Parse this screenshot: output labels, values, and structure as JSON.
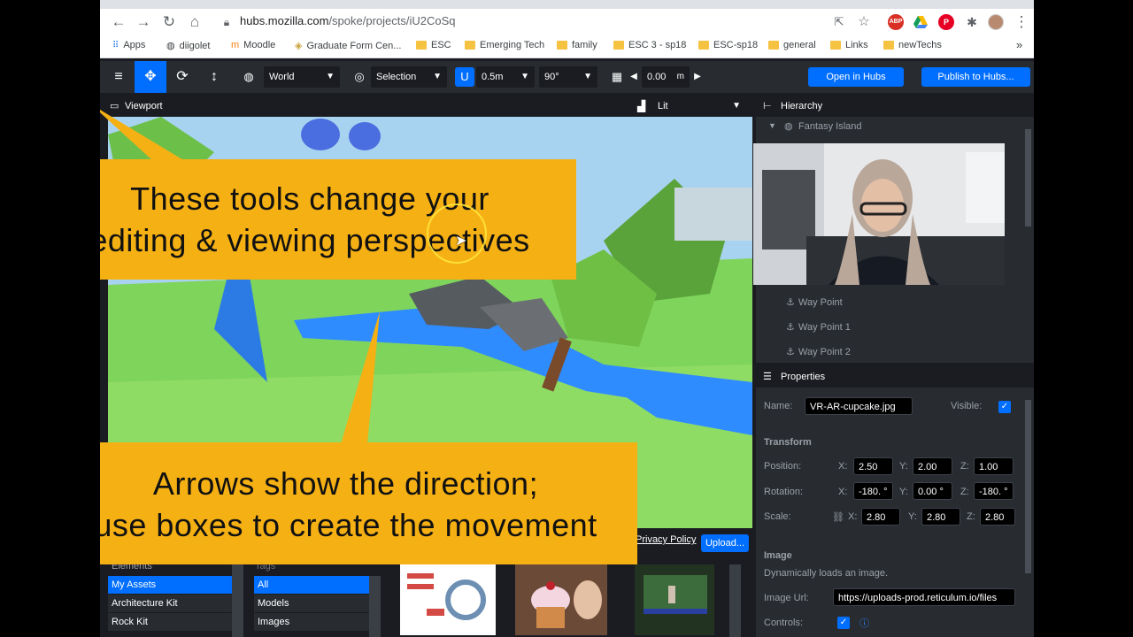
{
  "browser": {
    "url_host": "hubs.mozilla.com",
    "url_path": "/spoke/projects/iU2CoSq",
    "extensions": [
      "ABP",
      "drive-icon",
      "pinterest-icon",
      "puzzle-icon",
      "profile-avatar"
    ],
    "bookmarks": [
      {
        "label": "Apps",
        "icon": "apps-grid-icon"
      },
      {
        "label": "diigolet",
        "icon": "globe-icon"
      },
      {
        "label": "Moodle",
        "icon": "moodle-icon"
      },
      {
        "label": "Graduate Form Cen...",
        "icon": "shield-icon"
      },
      {
        "label": "ESC",
        "icon": "folder-icon"
      },
      {
        "label": "Emerging Tech",
        "icon": "folder-icon"
      },
      {
        "label": "family",
        "icon": "folder-icon"
      },
      {
        "label": "ESC 3 - sp18",
        "icon": "folder-icon"
      },
      {
        "label": "ESC-sp18",
        "icon": "folder-icon"
      },
      {
        "label": "general",
        "icon": "folder-icon"
      },
      {
        "label": "Links",
        "icon": "folder-icon"
      },
      {
        "label": "newTechs",
        "icon": "folder-icon"
      }
    ],
    "more": "»"
  },
  "toolbar": {
    "space_select": "World",
    "pivot_select": "Selection",
    "snap_value": "0.5m",
    "rotation_value": "90°",
    "grid_value": "0.00",
    "grid_unit": "m",
    "open_in_hubs": "Open in Hubs",
    "publish": "Publish to Hubs..."
  },
  "viewport": {
    "title": "Viewport",
    "render_mode": "Lit"
  },
  "hierarchy": {
    "title": "Hierarchy",
    "root": "Fantasy Island",
    "items": [
      "Way Point",
      "Way Point 1",
      "Way Point 2"
    ]
  },
  "properties": {
    "title": "Properties",
    "name_label": "Name:",
    "name_value": "VR-AR-cupcake.jpg",
    "visible_label": "Visible:",
    "transform_heading": "Transform",
    "position_label": "Position:",
    "rotation_label": "Rotation:",
    "scale_label": "Scale:",
    "axis_x": "X:",
    "axis_y": "Y:",
    "axis_z": "Z:",
    "position": {
      "x": "2.50",
      "y": "2.00",
      "z": "1.00"
    },
    "rotation": {
      "x": "-180. °",
      "y": "0.00 °",
      "z": "-180. °"
    },
    "scale": {
      "x": "2.80",
      "y": "2.80",
      "z": "2.80"
    },
    "image_heading": "Image",
    "image_desc": "Dynamically loads an image.",
    "image_url_label": "Image Url:",
    "image_url_value": "https://uploads-prod.reticulum.io/files",
    "controls_label": "Controls:"
  },
  "assets": {
    "sources": [
      "Elements",
      "My Assets",
      "Architecture Kit",
      "Rock Kit"
    ],
    "selected_source": "My Assets",
    "tags_label": "Tags",
    "tags": [
      "All",
      "Models",
      "Images"
    ],
    "selected_tag": "All",
    "privacy_policy": "Privacy Policy",
    "upload": "Upload..."
  },
  "callouts": {
    "top": [
      "These tools change your",
      "editing & viewing perspectives"
    ],
    "bottom": [
      "Arrows show the direction;",
      "use boxes to create the movement"
    ]
  },
  "colors": {
    "accent": "#006eff",
    "callout": "#f5b014",
    "panel": "#282c31",
    "panel_dark": "#1b1c21"
  }
}
